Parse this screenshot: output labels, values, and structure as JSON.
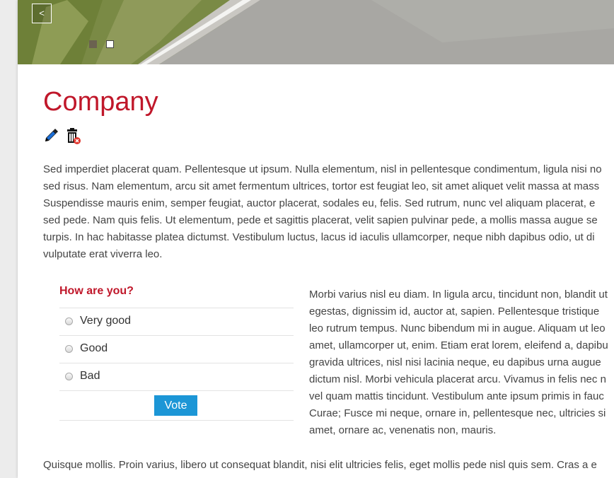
{
  "slider": {
    "prev_label": "<"
  },
  "article": {
    "title": "Company",
    "icons": [
      "pencil-icon",
      "trash-delete-icon"
    ],
    "intro_lines": [
      "Sed imperdiet placerat quam. Pellentesque ut ipsum. Nulla elementum, nisl in pellentesque condimentum, ligula nisi no",
      "sed risus. Nam elementum, arcu sit amet fermentum ultrices, tortor est feugiat leo, sit amet aliquet velit massa at mass",
      "Suspendisse mauris enim, semper feugiat, auctor placerat, sodales eu, felis. Sed rutrum, nunc vel aliquam placerat, e",
      "sed pede. Nam quis felis. Ut elementum, pede et sagittis placerat, velit sapien pulvinar pede, a mollis massa augue se",
      "turpis. In hac habitasse platea dictumst. Vestibulum luctus, lacus id iaculis ullamcorper, neque nibh dapibus odio, ut di",
      "vulputate erat viverra leo."
    ],
    "side_lines": [
      "Morbi varius nisl eu diam. In ligula arcu, tincidunt non, blandit ut",
      "egestas, dignissim id, auctor at, sapien. Pellentesque tristique",
      "leo rutrum tempus. Nunc bibendum mi in augue. Aliquam ut leo",
      "amet, ullamcorper ut, enim. Etiam erat lorem, eleifend a, dapibu",
      "gravida ultrices, nisl nisi lacinia neque, eu dapibus urna augue",
      "dictum nisl. Morbi vehicula placerat arcu. Vivamus in felis nec n",
      "vel quam mattis tincidunt. Vestibulum ante ipsum primis in fauc",
      "Curae; Fusce mi neque, ornare in, pellentesque nec, ultricies si",
      "amet, ornare ac, venenatis non, mauris."
    ],
    "bottom_line": "Quisque mollis. Proin varius, libero ut consequat blandit, nisi elit ultricies felis, eget mollis pede nisl quis sem. Cras a e"
  },
  "poll": {
    "question": "How are you?",
    "options": [
      "Very good",
      "Good",
      "Bad"
    ],
    "vote_label": "Vote",
    "accent_color": "#c0172a",
    "button_color": "#1c96d6"
  }
}
